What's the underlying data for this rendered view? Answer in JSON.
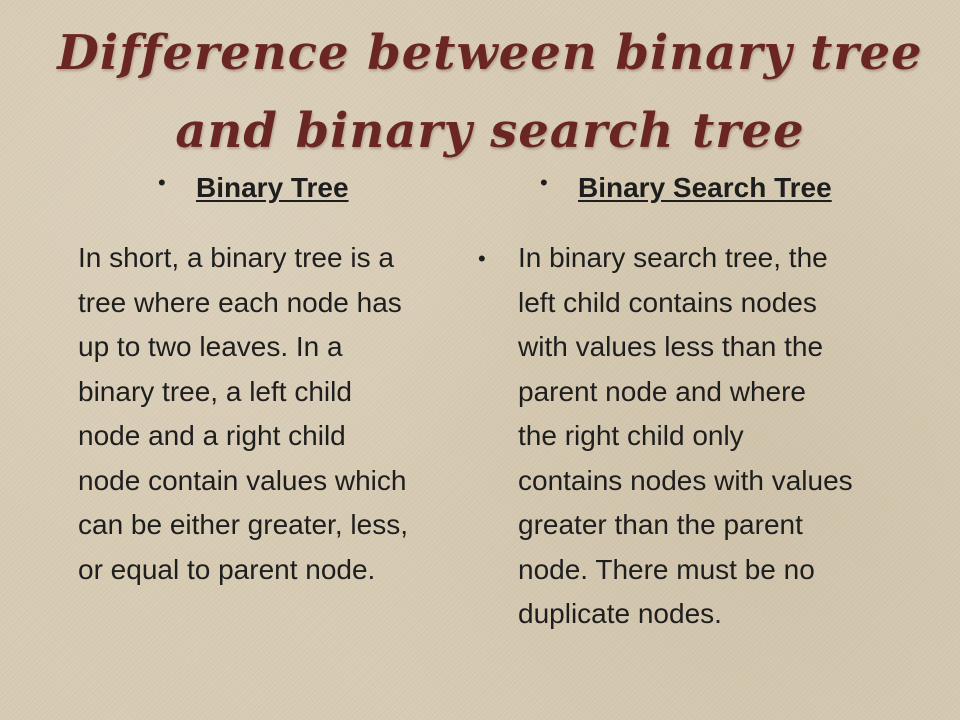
{
  "slide": {
    "title": "Difference between binary tree and binary search tree",
    "bullet_glyph": "•",
    "left": {
      "heading": "Binary Tree",
      "body": "In short, a binary tree is a\ntree where each node has\nup to two leaves. In a\nbinary tree, a left child\nnode and a right child\nnode contain values which\ncan be either greater, less,\nor equal to parent node."
    },
    "right": {
      "heading": "Binary Search Tree",
      "body": " In binary search tree, the\nleft child contains nodes\nwith values less than the\nparent node and where\nthe right child only\ncontains nodes with values\ngreater than the parent\nnode. There must be no\nduplicate nodes."
    },
    "colors": {
      "title": "#6a2623",
      "background": "#d9cdb6",
      "text": "#1e1e1e"
    }
  }
}
